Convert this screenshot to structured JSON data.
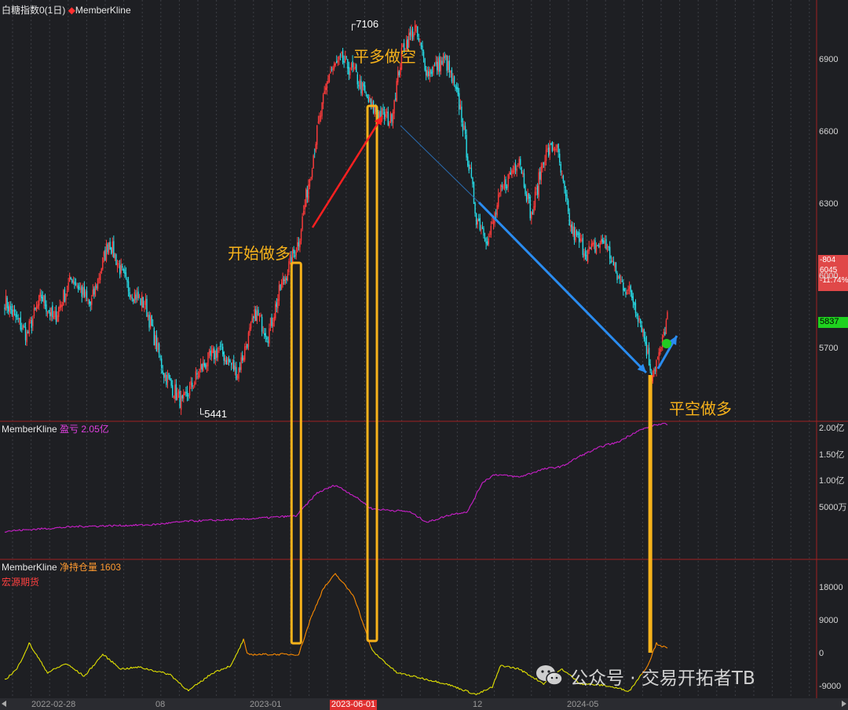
{
  "header": {
    "title": "白糖指数0(1日)",
    "indicator": "MemberKline"
  },
  "panel2": {
    "name": "MemberKline",
    "label": "盈亏 2.05亿"
  },
  "panel3": {
    "name": "MemberKline",
    "label": "净持仓量 1603",
    "broker": "宏源期货"
  },
  "annotations": {
    "open_long": "开始做多",
    "close_long_open_short": "平多做空",
    "close_short_open_long": "平空做多"
  },
  "price_box": {
    "change": "-804",
    "ref_price": "6045",
    "change_pct": "-11.74%",
    "last": "5837"
  },
  "watermark": "公众号 · 交易开拓者TB",
  "colors": {
    "background": "#1e1f23",
    "up_candle": "#ff3b3b",
    "down_candle": "#27dbe6",
    "pnl_line": "#d020d0",
    "net_position_above": "#ff8c00",
    "net_position_below": "#e6e600",
    "highlight_box": "#f7b21b",
    "arrow_up": "#ff2020",
    "arrow_down": "#2a8cf0",
    "grid_divider": "#a02020",
    "smiley": "#22cc22"
  },
  "chart_data": [
    {
      "type": "candlestick",
      "title": "白糖指数0(1日)",
      "ylim": [
        5400,
        7150
      ],
      "y_ticks": [
        5700,
        6000,
        6300,
        6600,
        6900
      ],
      "x_ticks": [
        "2022-02-28",
        "08",
        "2023-01",
        "2023-06-01",
        "12",
        "2024-05"
      ],
      "high_label": "7106",
      "low_label": "5441",
      "last_price": "5837",
      "anchors": [
        {
          "i": 0,
          "v": 5900
        },
        {
          "i": 18,
          "v": 5760
        },
        {
          "i": 30,
          "v": 5920
        },
        {
          "i": 40,
          "v": 5820
        },
        {
          "i": 55,
          "v": 6000
        },
        {
          "i": 70,
          "v": 5880
        },
        {
          "i": 85,
          "v": 6150
        },
        {
          "i": 100,
          "v": 5960
        },
        {
          "i": 115,
          "v": 5880
        },
        {
          "i": 130,
          "v": 5600
        },
        {
          "i": 145,
          "v": 5470
        },
        {
          "i": 160,
          "v": 5620
        },
        {
          "i": 175,
          "v": 5700
        },
        {
          "i": 190,
          "v": 5600
        },
        {
          "i": 205,
          "v": 5850
        },
        {
          "i": 215,
          "v": 5760
        },
        {
          "i": 225,
          "v": 5950
        },
        {
          "i": 240,
          "v": 6150
        },
        {
          "i": 255,
          "v": 6600
        },
        {
          "i": 265,
          "v": 6850
        },
        {
          "i": 275,
          "v": 6900
        },
        {
          "i": 285,
          "v": 6850
        },
        {
          "i": 300,
          "v": 6700
        },
        {
          "i": 315,
          "v": 6650
        },
        {
          "i": 325,
          "v": 6950
        },
        {
          "i": 335,
          "v": 7030
        },
        {
          "i": 345,
          "v": 6850
        },
        {
          "i": 360,
          "v": 6900
        },
        {
          "i": 372,
          "v": 6700
        },
        {
          "i": 385,
          "v": 6250
        },
        {
          "i": 395,
          "v": 6150
        },
        {
          "i": 405,
          "v": 6350
        },
        {
          "i": 420,
          "v": 6500
        },
        {
          "i": 430,
          "v": 6250
        },
        {
          "i": 440,
          "v": 6500
        },
        {
          "i": 450,
          "v": 6550
        },
        {
          "i": 462,
          "v": 6200
        },
        {
          "i": 475,
          "v": 6100
        },
        {
          "i": 490,
          "v": 6150
        },
        {
          "i": 500,
          "v": 6000
        },
        {
          "i": 512,
          "v": 5920
        },
        {
          "i": 520,
          "v": 5800
        },
        {
          "i": 528,
          "v": 5600
        },
        {
          "i": 535,
          "v": 5680
        },
        {
          "i": 541,
          "v": 5837
        }
      ]
    },
    {
      "type": "line",
      "title": "MemberKline 盈亏 2.05亿",
      "ylim": [
        -5000,
        21000
      ],
      "y_ticks": [
        "5000万",
        "1.00亿",
        "1.50亿",
        "2.00亿"
      ],
      "last_value": "2.05亿",
      "anchors": [
        {
          "i": 0,
          "v": 300
        },
        {
          "i": 60,
          "v": 1200
        },
        {
          "i": 120,
          "v": 1500
        },
        {
          "i": 150,
          "v": 2200
        },
        {
          "i": 190,
          "v": 2500
        },
        {
          "i": 238,
          "v": 3200
        },
        {
          "i": 255,
          "v": 7500
        },
        {
          "i": 270,
          "v": 9000
        },
        {
          "i": 285,
          "v": 7000
        },
        {
          "i": 300,
          "v": 4500
        },
        {
          "i": 330,
          "v": 4000
        },
        {
          "i": 345,
          "v": 2000
        },
        {
          "i": 365,
          "v": 3500
        },
        {
          "i": 378,
          "v": 4000
        },
        {
          "i": 390,
          "v": 9500
        },
        {
          "i": 400,
          "v": 11000
        },
        {
          "i": 420,
          "v": 10500
        },
        {
          "i": 440,
          "v": 12000
        },
        {
          "i": 455,
          "v": 12500
        },
        {
          "i": 470,
          "v": 14500
        },
        {
          "i": 490,
          "v": 16500
        },
        {
          "i": 500,
          "v": 17000
        },
        {
          "i": 515,
          "v": 19000
        },
        {
          "i": 530,
          "v": 20300
        },
        {
          "i": 541,
          "v": 20500
        }
      ]
    },
    {
      "type": "line",
      "title": "MemberKline 净持仓量 1603",
      "ylim": [
        -12000,
        26000
      ],
      "y_ticks": [
        -9000,
        0,
        9000,
        18000
      ],
      "last_value": "1603",
      "anchors": [
        {
          "i": 0,
          "v": -7000
        },
        {
          "i": 10,
          "v": -4000
        },
        {
          "i": 20,
          "v": 3000
        },
        {
          "i": 35,
          "v": -5000
        },
        {
          "i": 50,
          "v": -2500
        },
        {
          "i": 65,
          "v": -6000
        },
        {
          "i": 80,
          "v": 0
        },
        {
          "i": 95,
          "v": -4000
        },
        {
          "i": 110,
          "v": -3500
        },
        {
          "i": 135,
          "v": -5500
        },
        {
          "i": 150,
          "v": -10000
        },
        {
          "i": 170,
          "v": -5000
        },
        {
          "i": 185,
          "v": -3000
        },
        {
          "i": 195,
          "v": 4000
        },
        {
          "i": 198,
          "v": 0
        },
        {
          "i": 240,
          "v": 0
        },
        {
          "i": 250,
          "v": 10000
        },
        {
          "i": 260,
          "v": 18000
        },
        {
          "i": 270,
          "v": 22000
        },
        {
          "i": 285,
          "v": 16000
        },
        {
          "i": 300,
          "v": 1000
        },
        {
          "i": 320,
          "v": -5000
        },
        {
          "i": 340,
          "v": -6500
        },
        {
          "i": 360,
          "v": -8000
        },
        {
          "i": 385,
          "v": -11000
        },
        {
          "i": 398,
          "v": -9000
        },
        {
          "i": 405,
          "v": -3000
        },
        {
          "i": 420,
          "v": -4000
        },
        {
          "i": 440,
          "v": -8000
        },
        {
          "i": 455,
          "v": -4000
        },
        {
          "i": 470,
          "v": -8000
        },
        {
          "i": 490,
          "v": -8500
        },
        {
          "i": 510,
          "v": -10000
        },
        {
          "i": 525,
          "v": -3000
        },
        {
          "i": 532,
          "v": 3000
        },
        {
          "i": 541,
          "v": 1603
        }
      ]
    }
  ]
}
